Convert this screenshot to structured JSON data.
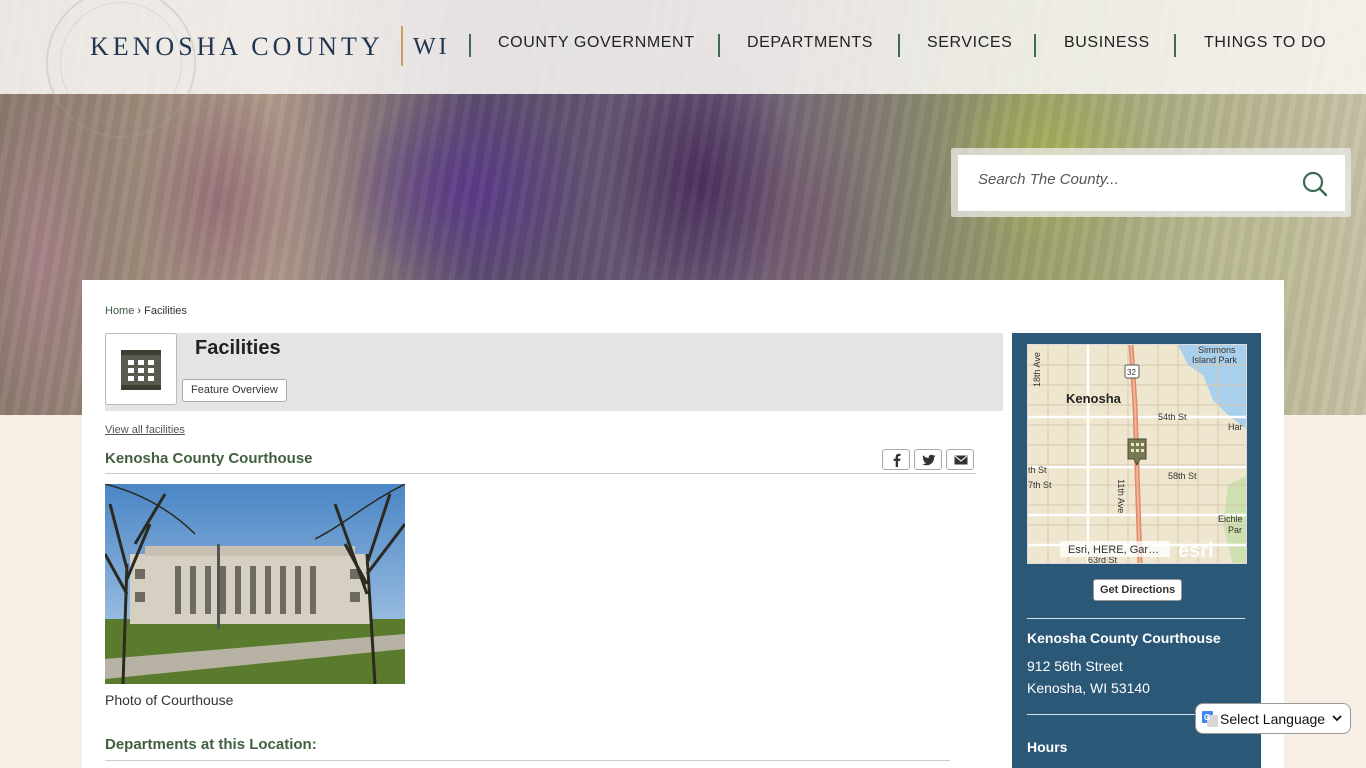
{
  "header": {
    "brand": "KENOSHA COUNTY",
    "state": "WI",
    "nav": [
      {
        "label": "COUNTY GOVERNMENT"
      },
      {
        "label": "DEPARTMENTS"
      },
      {
        "label": "SERVICES"
      },
      {
        "label": "BUSINESS"
      },
      {
        "label": "THINGS TO DO"
      }
    ]
  },
  "search": {
    "placeholder": "Search The County..."
  },
  "breadcrumb": {
    "home": "Home",
    "separator": "›",
    "current": "Facilities"
  },
  "page": {
    "title": "Facilities",
    "feature_button": "Feature Overview",
    "view_all": "View all facilities",
    "facility_name": "Kenosha County Courthouse",
    "photo_caption": "Photo of Courthouse",
    "departments_heading": "Departments at this Location:"
  },
  "sidebar": {
    "map": {
      "city": "Kenosha",
      "labels": [
        "18th Ave",
        "Simmons",
        "Island Park",
        "32",
        "54th St",
        "Har",
        "th St",
        "7th St",
        "58th St",
        "11th Ave",
        "Eichle",
        "Par",
        "63rd St"
      ],
      "attribution": "Esri, HERE, Gar…",
      "logo": "esri"
    },
    "directions_button": "Get Directions",
    "facility_name": "Kenosha County Courthouse",
    "address_line1": "912 56th Street",
    "address_line2": "Kenosha, WI 53140",
    "hours_heading": "Hours"
  },
  "translate": {
    "label": "Select Language"
  },
  "colors": {
    "header_text": "#1f3550",
    "accent_green": "#41603f",
    "sidebar_blue": "#2c5878",
    "divider_gold": "#c9a060"
  }
}
